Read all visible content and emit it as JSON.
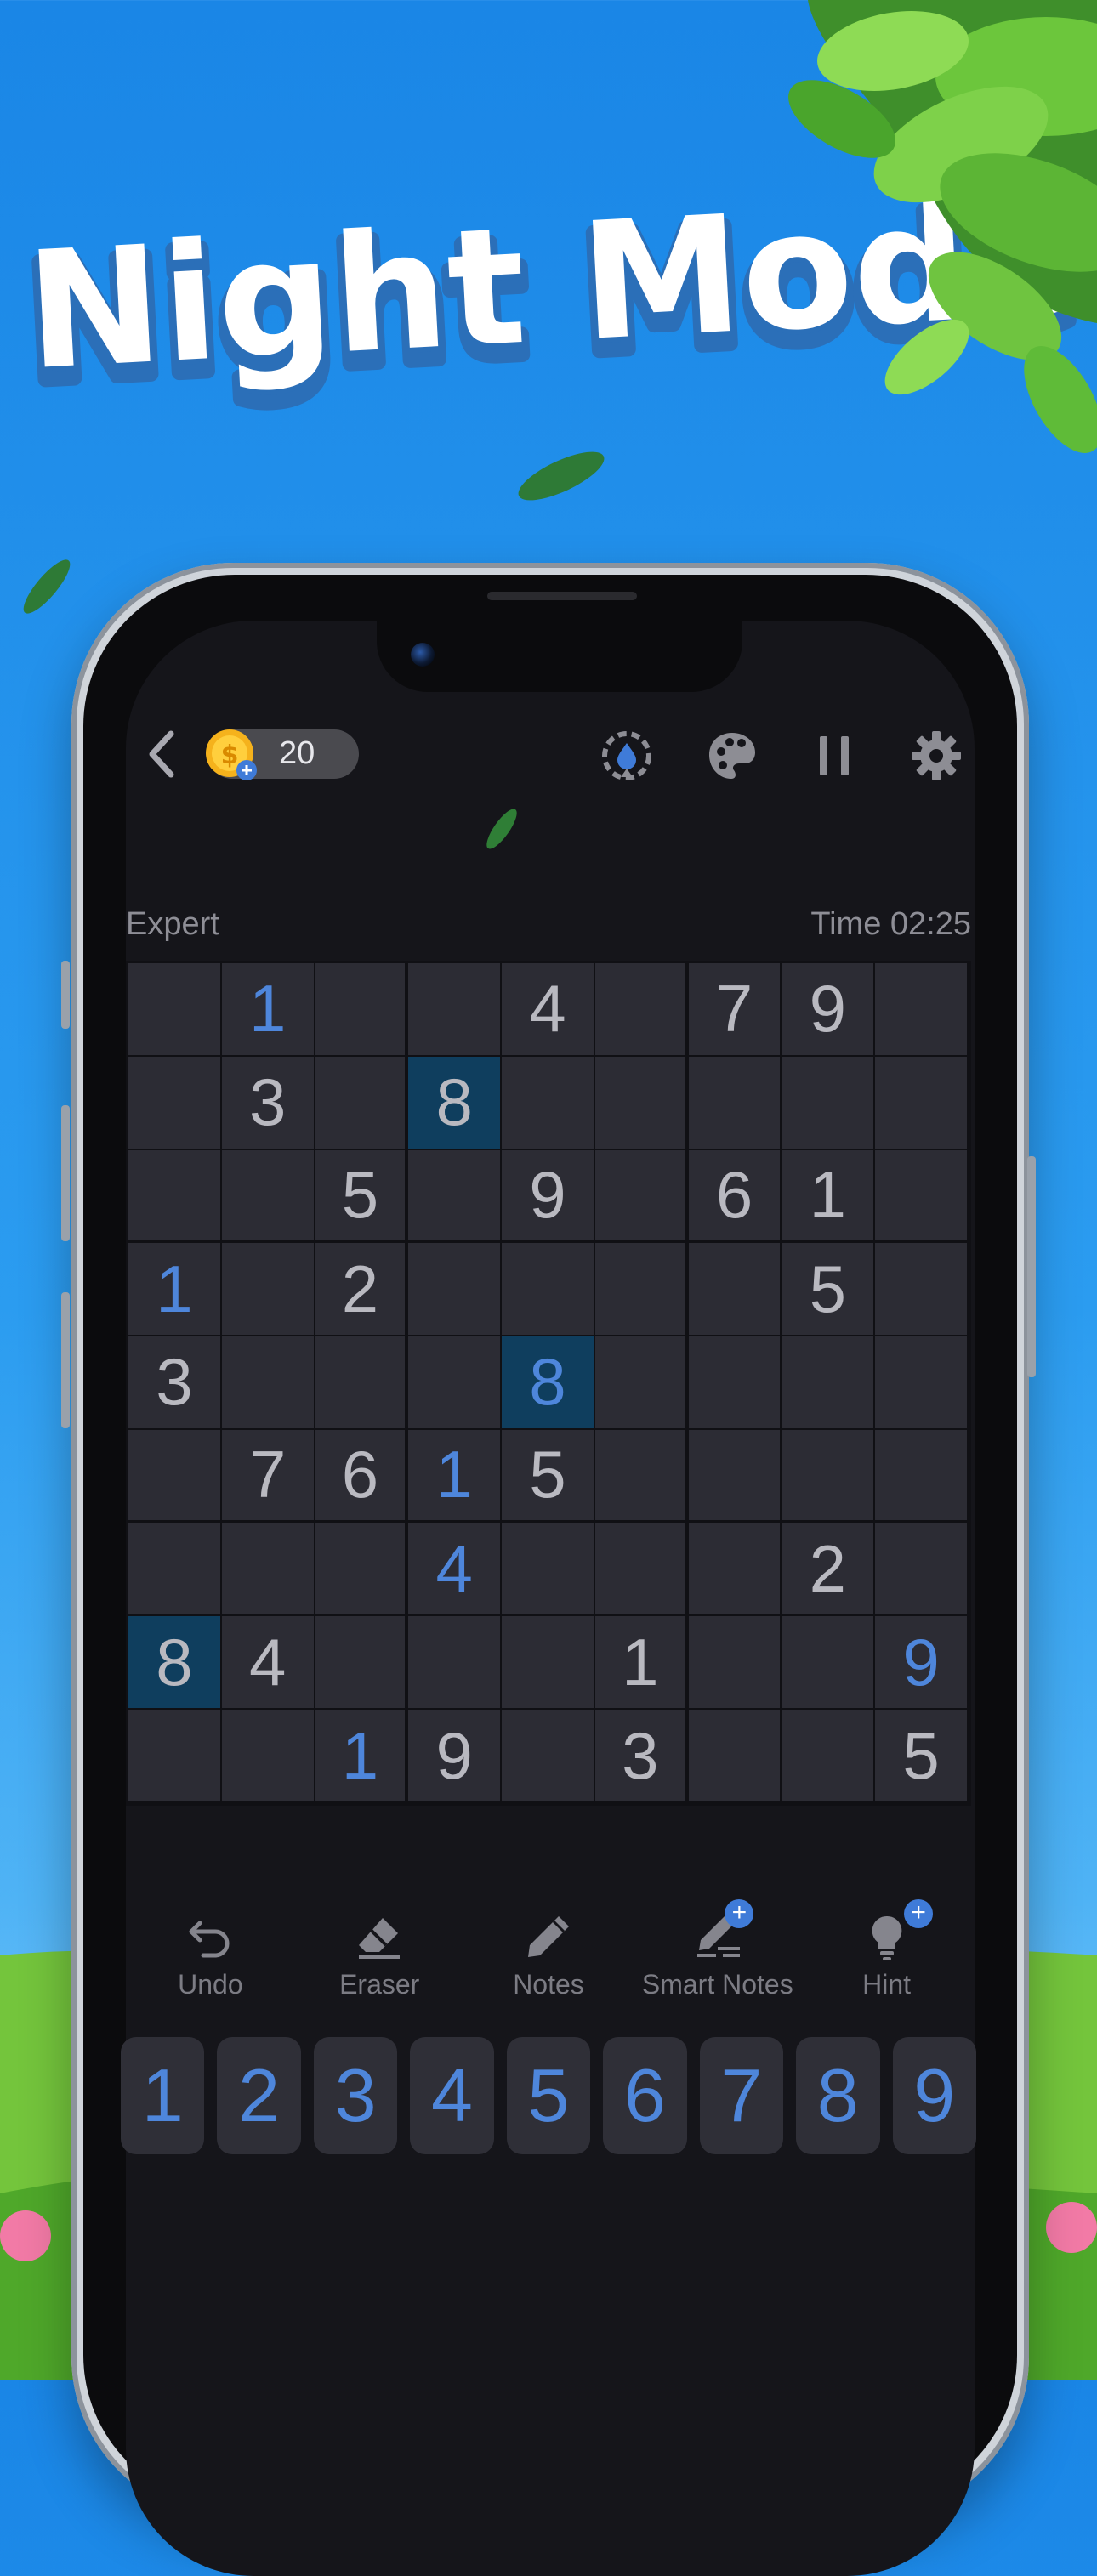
{
  "banner": {
    "title": "Night Mode"
  },
  "header": {
    "coins": "20",
    "icons": [
      "back-icon",
      "coin-icon",
      "ink-drop-icon",
      "palette-icon",
      "pause-icon",
      "gear-icon"
    ]
  },
  "game": {
    "difficulty": "Expert",
    "timer": "Time 02:25",
    "board": [
      [
        {
          "v": "",
          "u": false
        },
        {
          "v": "1",
          "u": true
        },
        {
          "v": "",
          "u": false
        },
        {
          "v": "",
          "u": false
        },
        {
          "v": "4",
          "u": false
        },
        {
          "v": "",
          "u": false
        },
        {
          "v": "7",
          "u": false
        },
        {
          "v": "9",
          "u": false
        },
        {
          "v": "",
          "u": false
        }
      ],
      [
        {
          "v": "",
          "u": false
        },
        {
          "v": "3",
          "u": false
        },
        {
          "v": "",
          "u": false
        },
        {
          "v": "8",
          "u": false,
          "h": true
        },
        {
          "v": "",
          "u": false
        },
        {
          "v": "",
          "u": false
        },
        {
          "v": "",
          "u": false
        },
        {
          "v": "",
          "u": false
        },
        {
          "v": "",
          "u": false
        }
      ],
      [
        {
          "v": "",
          "u": false
        },
        {
          "v": "",
          "u": false
        },
        {
          "v": "5",
          "u": false
        },
        {
          "v": "",
          "u": false
        },
        {
          "v": "9",
          "u": false
        },
        {
          "v": "",
          "u": false
        },
        {
          "v": "6",
          "u": false
        },
        {
          "v": "1",
          "u": false
        },
        {
          "v": "",
          "u": false
        }
      ],
      [
        {
          "v": "1",
          "u": true
        },
        {
          "v": "",
          "u": false
        },
        {
          "v": "2",
          "u": false
        },
        {
          "v": "",
          "u": false
        },
        {
          "v": "",
          "u": false
        },
        {
          "v": "",
          "u": false
        },
        {
          "v": "",
          "u": false
        },
        {
          "v": "5",
          "u": false
        },
        {
          "v": "",
          "u": false
        }
      ],
      [
        {
          "v": "3",
          "u": false
        },
        {
          "v": "",
          "u": false
        },
        {
          "v": "",
          "u": false
        },
        {
          "v": "",
          "u": false
        },
        {
          "v": "8",
          "u": true,
          "h": true
        },
        {
          "v": "",
          "u": false
        },
        {
          "v": "",
          "u": false
        },
        {
          "v": "",
          "u": false
        },
        {
          "v": "",
          "u": false
        }
      ],
      [
        {
          "v": "",
          "u": false
        },
        {
          "v": "7",
          "u": false
        },
        {
          "v": "6",
          "u": false
        },
        {
          "v": "1",
          "u": true
        },
        {
          "v": "5",
          "u": false
        },
        {
          "v": "",
          "u": false
        },
        {
          "v": "",
          "u": false
        },
        {
          "v": "",
          "u": false
        },
        {
          "v": "",
          "u": false
        }
      ],
      [
        {
          "v": "",
          "u": false
        },
        {
          "v": "",
          "u": false
        },
        {
          "v": "",
          "u": false
        },
        {
          "v": "4",
          "u": true
        },
        {
          "v": "",
          "u": false
        },
        {
          "v": "",
          "u": false
        },
        {
          "v": "",
          "u": false
        },
        {
          "v": "2",
          "u": false
        },
        {
          "v": "",
          "u": false
        }
      ],
      [
        {
          "v": "8",
          "u": false,
          "h": true
        },
        {
          "v": "4",
          "u": false
        },
        {
          "v": "",
          "u": false
        },
        {
          "v": "",
          "u": false
        },
        {
          "v": "",
          "u": false
        },
        {
          "v": "1",
          "u": false
        },
        {
          "v": "",
          "u": false
        },
        {
          "v": "",
          "u": false
        },
        {
          "v": "9",
          "u": true
        }
      ],
      [
        {
          "v": "",
          "u": false
        },
        {
          "v": "",
          "u": false
        },
        {
          "v": "1",
          "u": true
        },
        {
          "v": "9",
          "u": false
        },
        {
          "v": "",
          "u": false
        },
        {
          "v": "3",
          "u": false
        },
        {
          "v": "",
          "u": false
        },
        {
          "v": "",
          "u": false
        },
        {
          "v": "5",
          "u": false
        }
      ]
    ]
  },
  "actions": [
    {
      "label": "Undo",
      "icon": "undo-icon",
      "plus": false
    },
    {
      "label": "Eraser",
      "icon": "eraser-icon",
      "plus": false
    },
    {
      "label": "Notes",
      "icon": "pencil-icon",
      "plus": false
    },
    {
      "label": "Smart Notes",
      "icon": "smart-notes-icon",
      "plus": true
    },
    {
      "label": "Hint",
      "icon": "lightbulb-icon",
      "plus": true
    }
  ],
  "numpad": [
    "1",
    "2",
    "3",
    "4",
    "5",
    "6",
    "7",
    "8",
    "9"
  ],
  "colors": {
    "sky": "#1a86e6",
    "board_bg": "#2c2c34",
    "user_digit": "#4e86db",
    "given_digit": "#b9b9c0",
    "highlight": "#0f3e5e"
  }
}
